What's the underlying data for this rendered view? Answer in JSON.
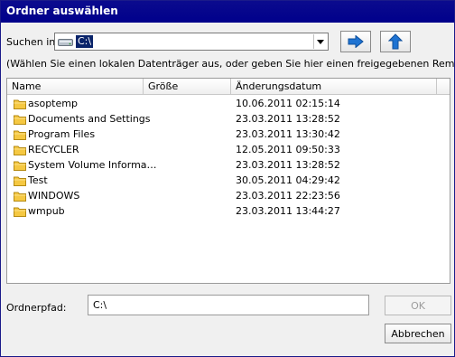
{
  "window": {
    "title": "Ordner auswählen"
  },
  "lookin": {
    "label": "Suchen in:",
    "value": "C:\\",
    "drive_icon": "drive-icon",
    "dropdown_icon": "chevron-down-icon"
  },
  "toolbar": {
    "forward_icon": "arrow-right-icon",
    "up_icon": "arrow-up-icon"
  },
  "hint": "(Wählen Sie einen lokalen Datenträger aus, oder geben Sie hier einen freigegebenen Remote-Pfad",
  "list": {
    "columns": {
      "name": "Name",
      "size": "Größe",
      "date": "Änderungsdatum"
    },
    "rows": [
      {
        "name": "asoptemp",
        "size": "",
        "date": "10.06.2011 02:15:14"
      },
      {
        "name": "Documents and Settings",
        "size": "",
        "date": "23.03.2011 13:28:52"
      },
      {
        "name": "Program Files",
        "size": "",
        "date": "23.03.2011 13:30:42"
      },
      {
        "name": "RECYCLER",
        "size": "",
        "date": "12.05.2011 09:50:33"
      },
      {
        "name": "System Volume Informa…",
        "size": "",
        "date": "23.03.2011 13:28:52"
      },
      {
        "name": "Test",
        "size": "",
        "date": "30.05.2011 04:29:42"
      },
      {
        "name": "WINDOWS",
        "size": "",
        "date": "23.03.2011 22:23:56"
      },
      {
        "name": "wmpub",
        "size": "",
        "date": "23.03.2011 13:44:27"
      }
    ],
    "row_icon": "folder-icon"
  },
  "folderpath": {
    "label": "Ordnerpfad:",
    "value": "C:\\"
  },
  "buttons": {
    "ok": "OK",
    "cancel": "Abbrechen"
  },
  "colors": {
    "titlebar": "#00008b",
    "selection": "#0a246a",
    "folder": "#f5c842",
    "button_arrow": "#1e73d2"
  }
}
